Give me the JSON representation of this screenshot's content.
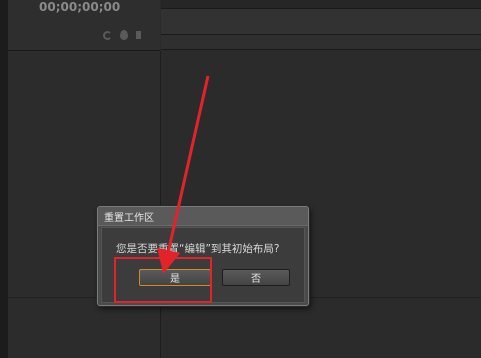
{
  "timeline": {
    "timecode": "00;00;00;00",
    "tools": [
      {
        "icon": "snap-icon"
      },
      {
        "icon": "marker-icon"
      },
      {
        "icon": "wrench-icon"
      }
    ]
  },
  "dialog": {
    "title": "重置工作区",
    "message": "您是否要重置“编辑”到其初始布局?",
    "yes_label": "是",
    "no_label": "否"
  },
  "annotation": {
    "arrow_color": "#e2232a",
    "box_color": "#e2232a"
  },
  "colors": {
    "background": "#2b2b2b",
    "dialog_bg": "#4a4a4a",
    "focus_border": "#d08a2a"
  }
}
